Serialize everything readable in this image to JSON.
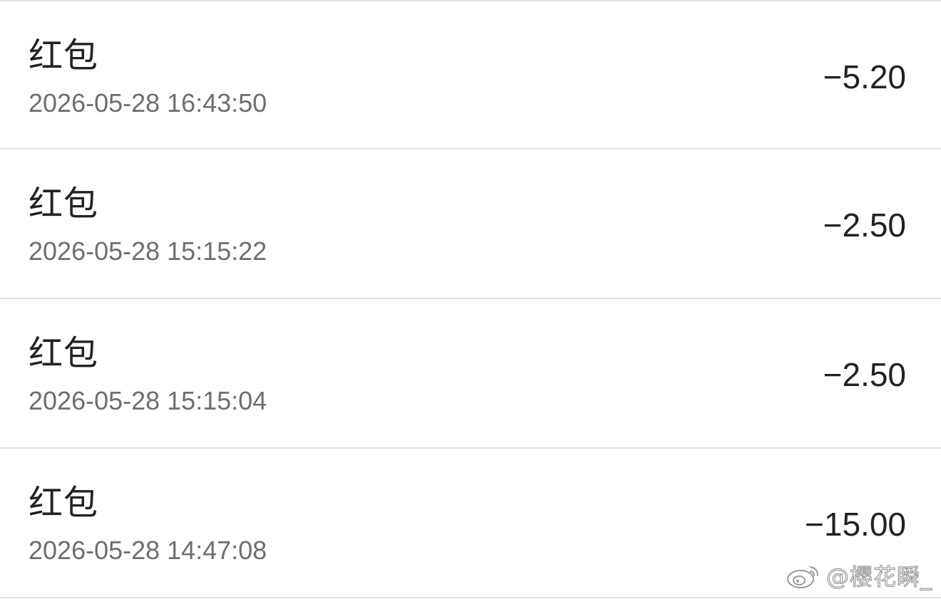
{
  "transactions": [
    {
      "title": "红包",
      "time": "2026-05-28 16:43:50",
      "amount": "−5.20"
    },
    {
      "title": "红包",
      "time": "2026-05-28 15:15:22",
      "amount": "−2.50"
    },
    {
      "title": "红包",
      "time": "2026-05-28 15:15:04",
      "amount": "−2.50"
    },
    {
      "title": "红包",
      "time": "2026-05-28 14:47:08",
      "amount": "−15.00"
    }
  ],
  "watermark": {
    "icon": "weibo-icon",
    "text": "@樱花瞬_"
  },
  "colors": {
    "background": "#ffffff",
    "title_text": "#222222",
    "time_text": "#6e6e6e",
    "amount_text": "#222222",
    "divider": "#e2e2e2"
  }
}
